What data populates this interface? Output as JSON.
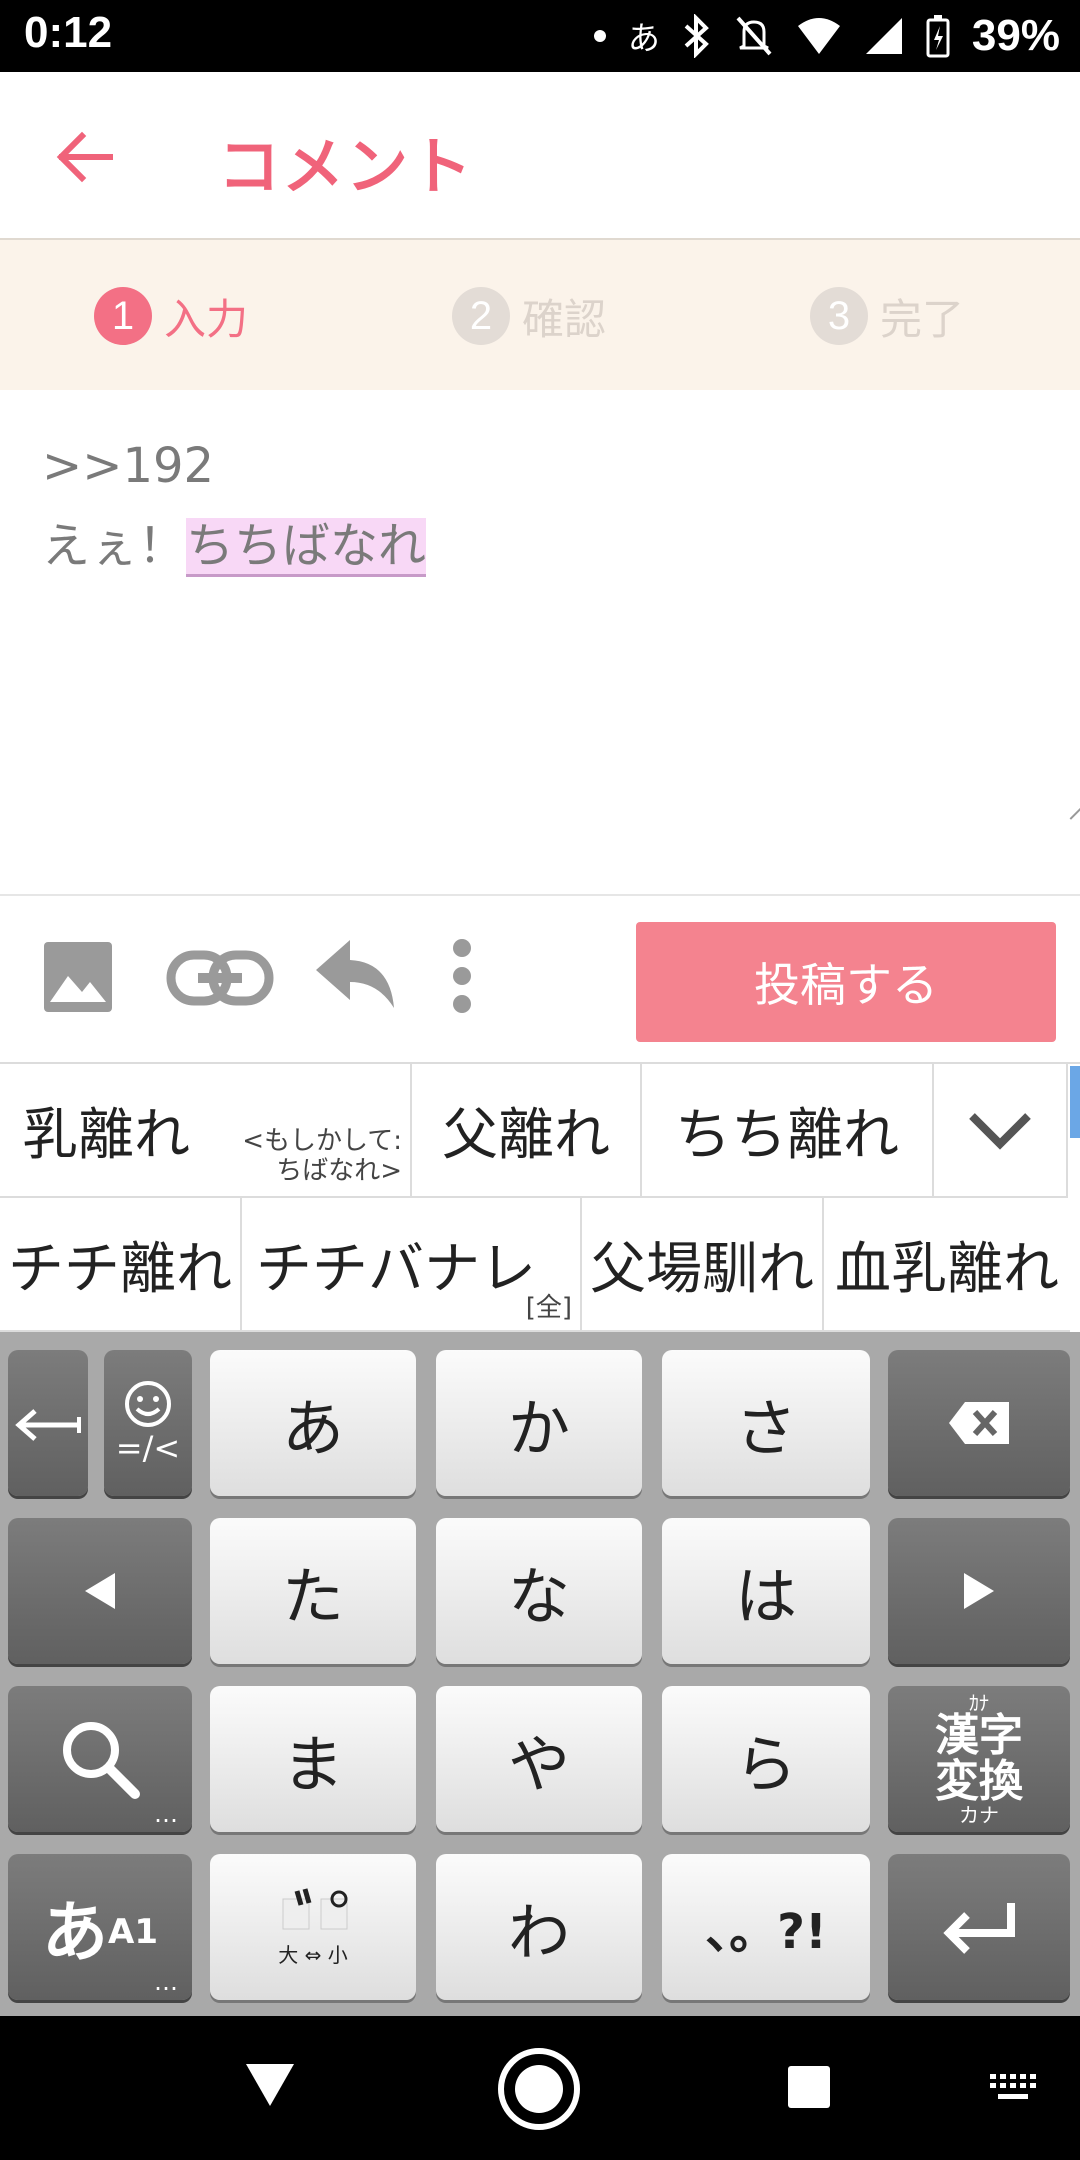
{
  "status_bar": {
    "time": "0:12",
    "ime_indicator": "あ",
    "battery": "39%",
    "icons": [
      "dot-icon",
      "bluetooth-icon",
      "bell-off-icon",
      "wifi-icon",
      "signal-icon",
      "battery-charging-icon"
    ]
  },
  "header": {
    "title": "コメント",
    "back_icon": "arrow-left-icon",
    "accent_color": "#f0637a"
  },
  "steps": [
    {
      "num": "1",
      "label": "入力",
      "active": true
    },
    {
      "num": "2",
      "label": "確認",
      "active": false
    },
    {
      "num": "3",
      "label": "完了",
      "active": false
    }
  ],
  "comment": {
    "line1": ">>192",
    "line2_prefix": "えぇ！",
    "composing_text": "ちちばなれ"
  },
  "toolbar": {
    "post_label": "投稿する",
    "post_color": "#f4838f",
    "icons": [
      "image-icon",
      "link-icon",
      "reply-icon",
      "more-vertical-icon"
    ]
  },
  "suggestions": {
    "row1": [
      {
        "text": "乳離れ",
        "sub1": "<もしかして:",
        "sub2": "ちばなれ>"
      },
      {
        "text": "父離れ"
      },
      {
        "text": "ちち離れ"
      }
    ],
    "row2": [
      {
        "text": "チチ離れ"
      },
      {
        "text": "チチバナレ",
        "tag": "[全]"
      },
      {
        "text": "父場馴れ"
      },
      {
        "text": "血乳離れ"
      }
    ],
    "expand_icon": "chevron-down-icon"
  },
  "keyboard": {
    "row1": [
      "あ",
      "か",
      "さ"
    ],
    "row2": [
      "た",
      "な",
      "は"
    ],
    "row3": [
      "ま",
      "や",
      "ら"
    ],
    "row4": [
      "わ",
      "、。?!"
    ],
    "emoji_label": "=/<",
    "kanji_top": "ｶﾅ",
    "kanji_main": "漢字\n変換",
    "kanji_bottom": "カナ",
    "mode_main": "あ",
    "mode_sub": "A1",
    "dakuten_bottom": "大 ⇔ 小",
    "dots": "…"
  }
}
